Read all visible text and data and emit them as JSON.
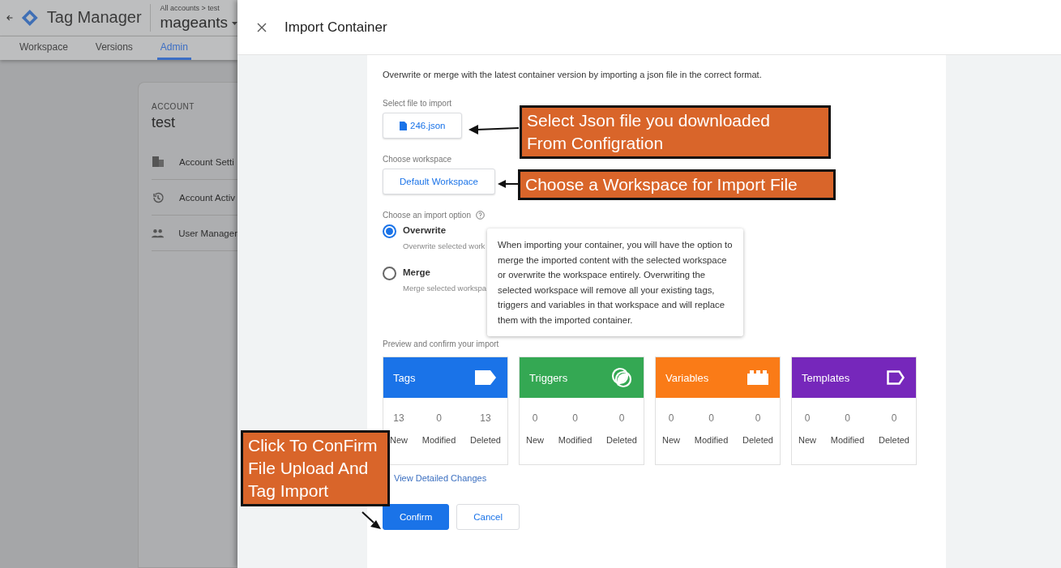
{
  "app": {
    "product": "Tag Manager",
    "breadcrumb": "All accounts > test",
    "container": "mageants",
    "tabs": [
      {
        "label": "Workspace",
        "selected": false
      },
      {
        "label": "Versions",
        "selected": false
      },
      {
        "label": "Admin",
        "selected": true
      }
    ],
    "account": {
      "label": "ACCOUNT",
      "name": "test",
      "items": [
        {
          "kind": "building",
          "label": "Account Setti"
        },
        {
          "kind": "history",
          "label": "Account Activ"
        },
        {
          "kind": "people",
          "label": "User Manager"
        }
      ]
    }
  },
  "dialog": {
    "title": "Import Container",
    "intro": "Overwrite or merge with the latest container version by importing a json file in the correct format.",
    "file_label": "Select file to import",
    "file_name": "246.json",
    "workspace_label": "Choose workspace",
    "workspace_button": "Default Workspace",
    "option_label": "Choose an import option",
    "options": [
      {
        "title": "Overwrite",
        "desc": "Overwrite selected work",
        "selected": true
      },
      {
        "title": "Merge",
        "desc": "Merge selected workspa",
        "selected": false
      }
    ],
    "tooltip": "When importing your container, you will have the option to merge the imported content with the selected workspace or overwrite the workspace entirely. Overwriting the selected workspace will remove all your existing tags, triggers and variables in that workspace and will replace them with the imported container.",
    "preview_label": "Preview and confirm your import",
    "cards": [
      {
        "title": "Tags",
        "kind": "tag",
        "color": "#1a73e8",
        "stats": [
          {
            "value": "13",
            "label": "New"
          },
          {
            "value": "0",
            "label": "Modified"
          },
          {
            "value": "13",
            "label": "Deleted"
          }
        ]
      },
      {
        "title": "Triggers",
        "kind": "trigger",
        "color": "#34a853",
        "stats": [
          {
            "value": "0",
            "label": "New"
          },
          {
            "value": "0",
            "label": "Modified"
          },
          {
            "value": "0",
            "label": "Deleted"
          }
        ]
      },
      {
        "title": "Variables",
        "kind": "variable",
        "color": "#fa7b17",
        "stats": [
          {
            "value": "0",
            "label": "New"
          },
          {
            "value": "0",
            "label": "Modified"
          },
          {
            "value": "0",
            "label": "Deleted"
          }
        ]
      },
      {
        "title": "Templates",
        "kind": "template",
        "color": "#7627bb",
        "stats": [
          {
            "value": "0",
            "label": "New"
          },
          {
            "value": "0",
            "label": "Modified"
          },
          {
            "value": "0",
            "label": "Deleted"
          }
        ]
      }
    ],
    "link": "View Detailed Changes",
    "buttons": [
      {
        "label": "Confirm",
        "kind": "primary"
      },
      {
        "label": "Cancel",
        "kind": "secondary"
      }
    ]
  },
  "callouts": [
    {
      "text": "Select Json file you downloaded\nFrom Configration"
    },
    {
      "text": "Choose a Workspace for Import File"
    },
    {
      "text": "Click To ConFirm\nFile Upload And\nTag Import"
    }
  ]
}
